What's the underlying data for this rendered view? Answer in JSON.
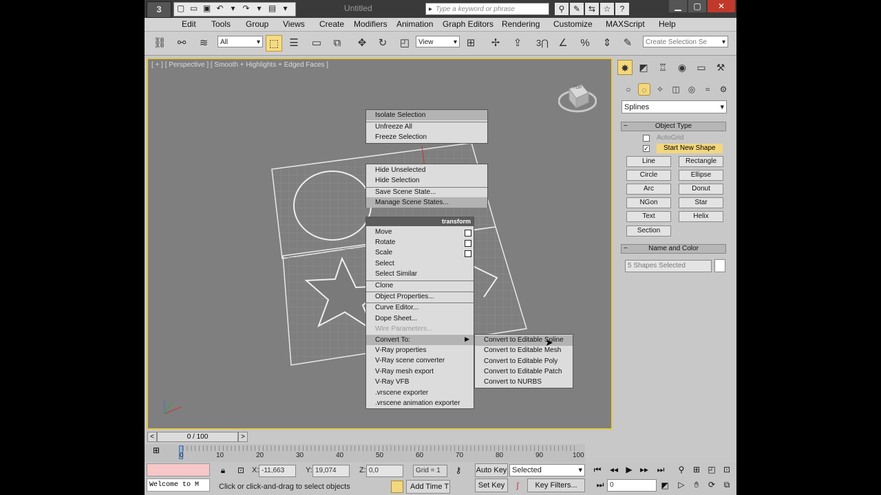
{
  "window": {
    "title": "Untitled",
    "search_placeholder": "Type a keyword or phrase",
    "logo": "3"
  },
  "menu": [
    "Edit",
    "Tools",
    "Group",
    "Views",
    "Create",
    "Modifiers",
    "Animation",
    "Graph Editors",
    "Rendering",
    "Customize",
    "MAXScript",
    "Help"
  ],
  "toolbar": {
    "filter_value": "All",
    "refcoord_value": "View",
    "selection_set_placeholder": "Create Selection Se",
    "snap_label": "3"
  },
  "viewport": {
    "label": "[ + ] [ Perspective ] [ Smooth + Highlights + Edged Faces ]",
    "viewcube_label": "TOP"
  },
  "quad_menu": {
    "top_left": [
      "Isolate Selection",
      "Unfreeze All",
      "Freeze Selection"
    ],
    "middle_left": [
      "Hide Unselected",
      "Hide Selection",
      "Save Scene State...",
      "Manage Scene States..."
    ],
    "transform": {
      "header": "transform",
      "items": [
        "Move",
        "Rotate",
        "Scale",
        "Select",
        "Select Similar",
        "Clone",
        "Object Properties...",
        "Curve Editor...",
        "Dope Sheet...",
        "Wire Parameters...",
        "Convert To:",
        "V-Ray properties",
        "V-Ray scene converter",
        "V-Ray mesh export",
        "V-Ray VFB",
        ".vrscene exporter",
        ".vrscene animation exporter"
      ]
    },
    "convert_submenu": [
      "Convert to Editable Spline",
      "Convert to Editable Mesh",
      "Convert to Editable Poly",
      "Convert to Editable Patch",
      "Convert to NURBS"
    ]
  },
  "command_panel": {
    "category": "Splines",
    "object_type": {
      "title": "Object Type",
      "autogrid": "AutoGrid",
      "start_new_shape": "Start New Shape",
      "buttons": [
        "Line",
        "Rectangle",
        "Circle",
        "Ellipse",
        "Arc",
        "Donut",
        "NGon",
        "Star",
        "Text",
        "Helix",
        "Section"
      ]
    },
    "name_color": {
      "title": "Name and Color",
      "value": "5 Shapes Selected",
      "swatch_color": "#ffffff"
    }
  },
  "timeline": {
    "frame": "0 / 100",
    "ticks": [
      "0",
      "10",
      "20",
      "30",
      "40",
      "50",
      "60",
      "70",
      "80",
      "90",
      "100"
    ]
  },
  "status": {
    "listener": "Welcome to M",
    "prompt": "Click or click-and-drag to select objects",
    "x_label": "X:",
    "x_value": "-11,663",
    "y_label": "Y:",
    "y_value": "19,074",
    "z_label": "Z:",
    "z_value": "0,0",
    "grid": "Grid = 1",
    "add_time_tag": "Add Time T",
    "auto_key": "Auto Key",
    "set_key": "Set Key",
    "key_mode": "Selected",
    "key_filters": "Key Filters...",
    "current_frame": "0"
  },
  "colors": {
    "accent": "#f3d77e",
    "viewport_bg": "#7f7f7f",
    "viewport_border": "#e6c84a"
  }
}
